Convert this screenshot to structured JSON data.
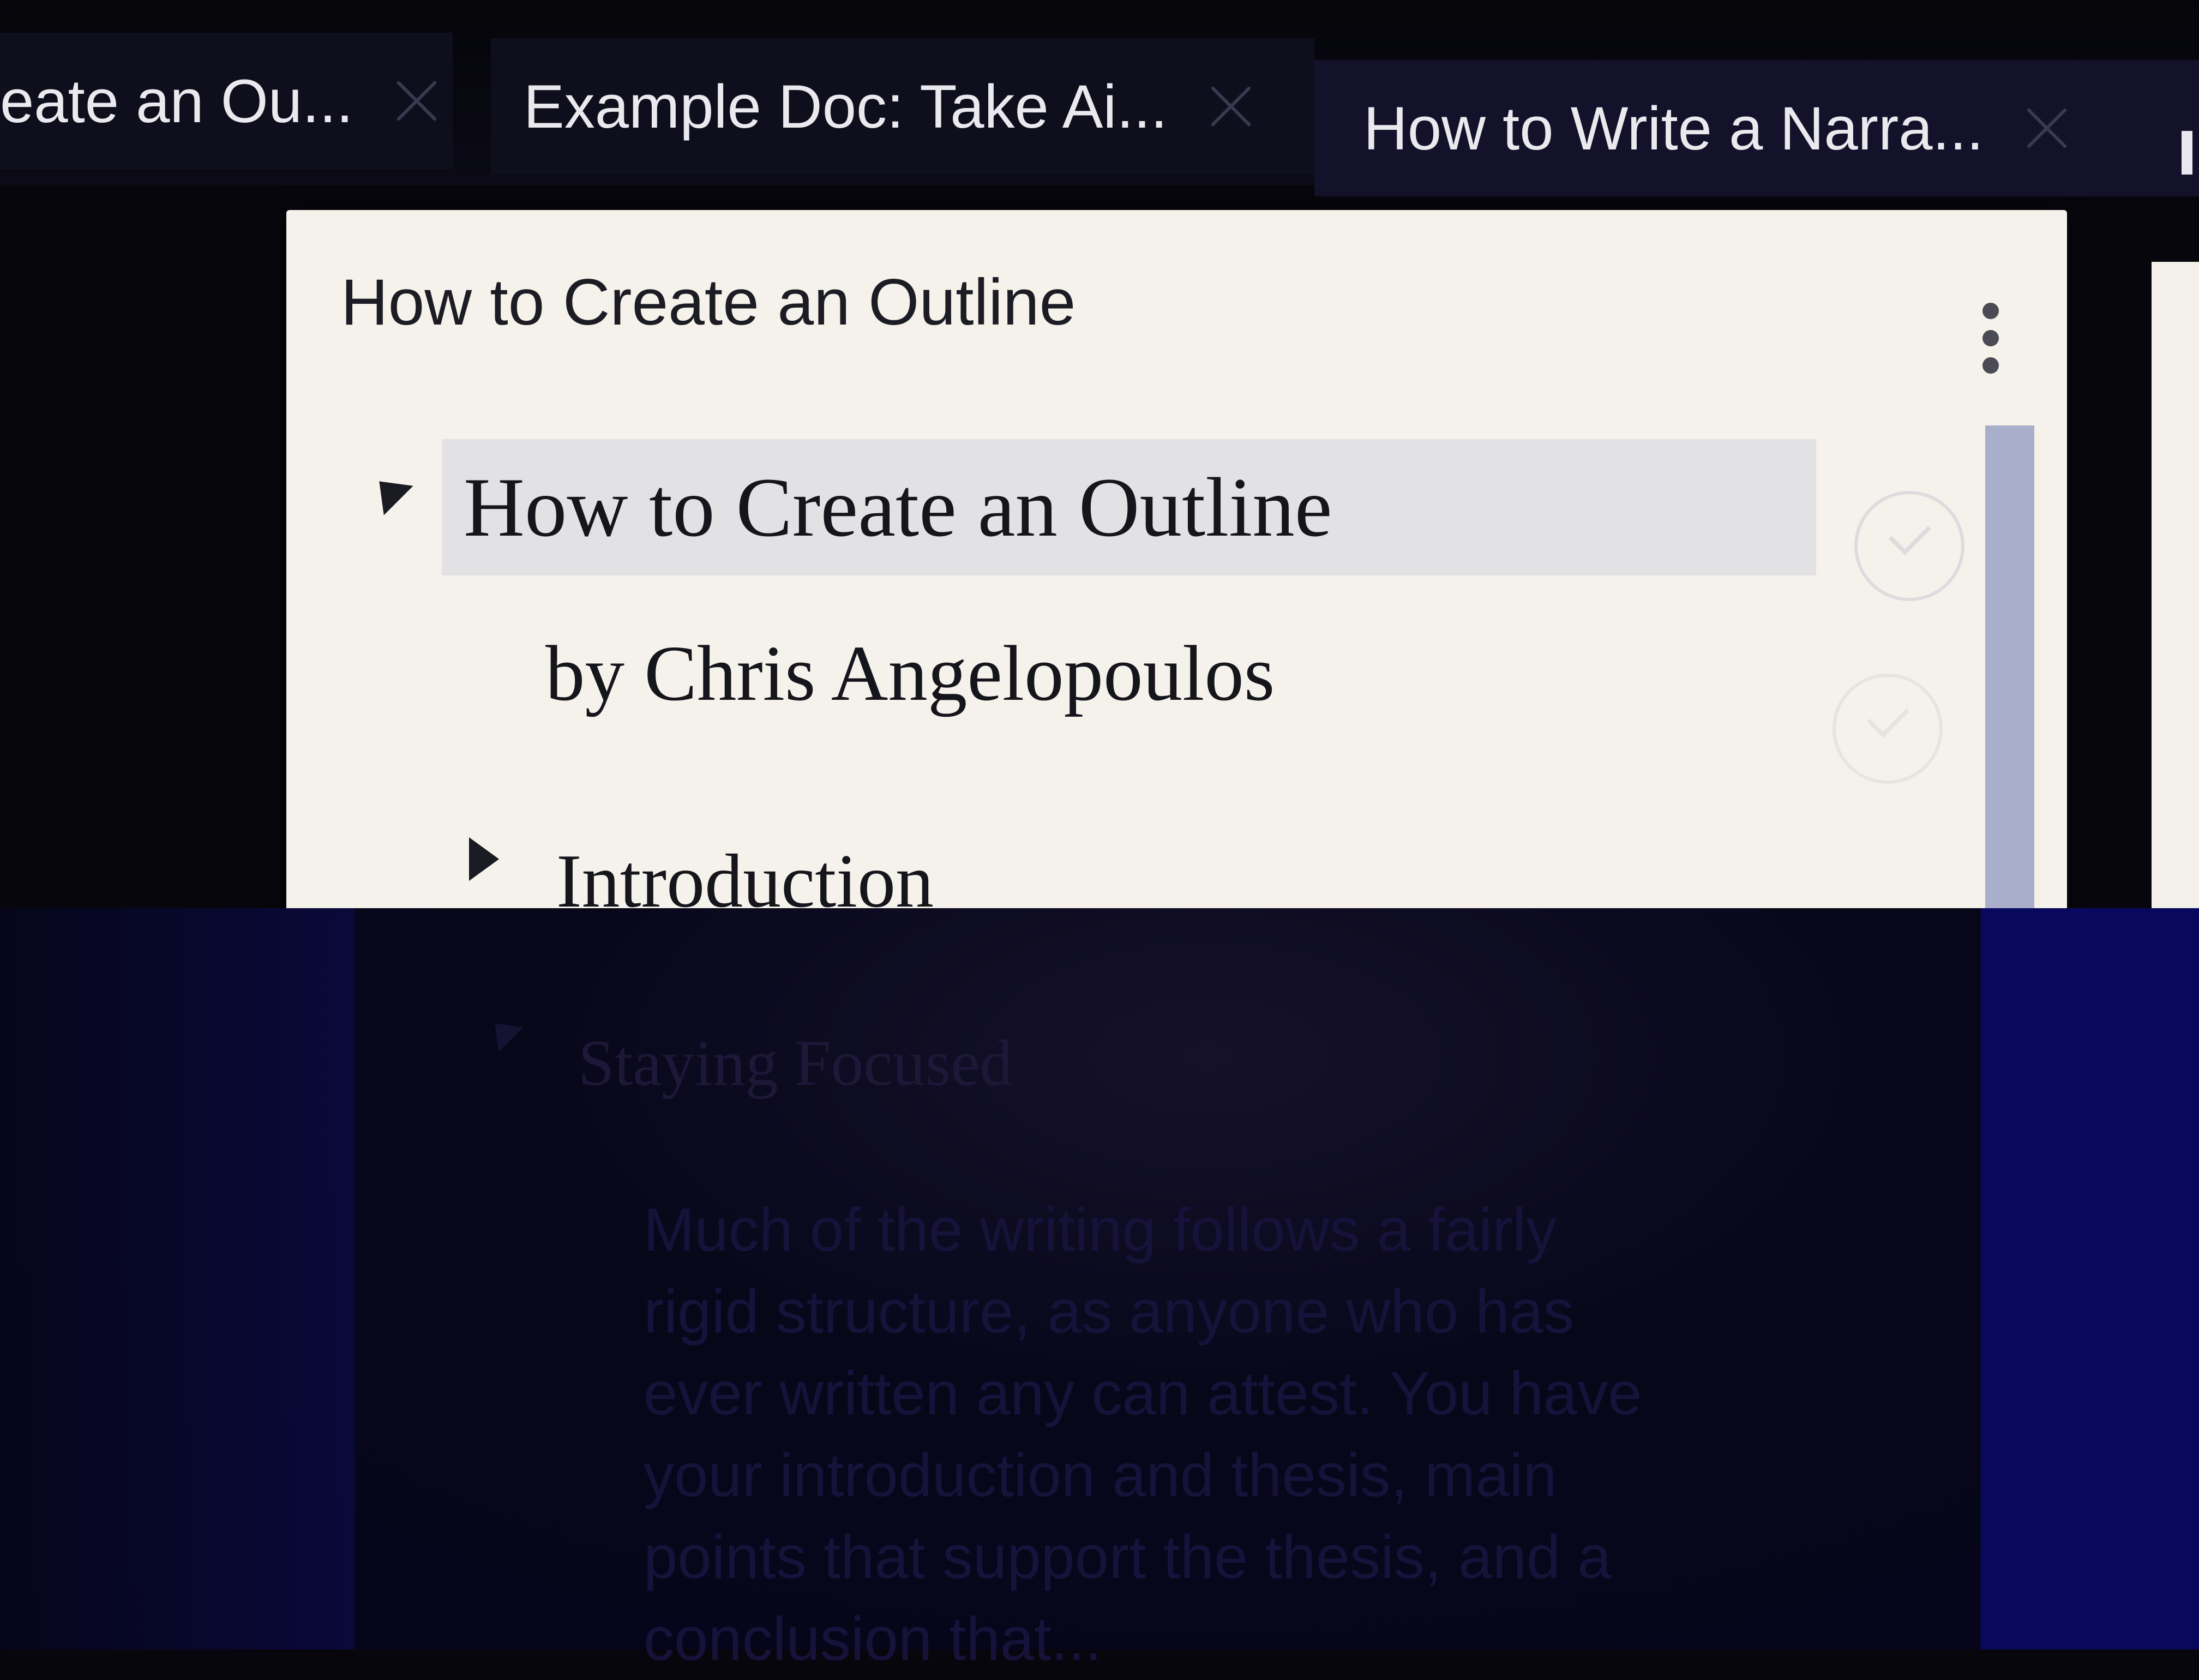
{
  "tabs": [
    {
      "label": "eate an Ou...",
      "active": false
    },
    {
      "label": "Example Doc: Take Ai...",
      "active": false
    },
    {
      "label": "How to Write a Narra...",
      "active": true
    }
  ],
  "panel": {
    "title": "How to Create an Outline",
    "menu_icon": "kebab-menu-icon"
  },
  "outline": {
    "items": [
      {
        "label": "How to Create an Outline",
        "expanded": true,
        "selected": true
      },
      {
        "label": "by Chris Angelopoulos"
      },
      {
        "label": "Introduction",
        "expanded": false
      }
    ]
  },
  "background": {
    "heading": "Staying Focused",
    "paragraph": "Much of the writing follows a fairly rigid structure, as anyone who has ever written any can attest. You have your introduction and thesis, main points that support the thesis, and a conclusion that..."
  },
  "colors": {
    "panel_bg": "#f4f2ea",
    "tab_bg": "#0f0e1c",
    "selected_row": "#e2e2e4",
    "scrollbar": "#a9aecb"
  }
}
